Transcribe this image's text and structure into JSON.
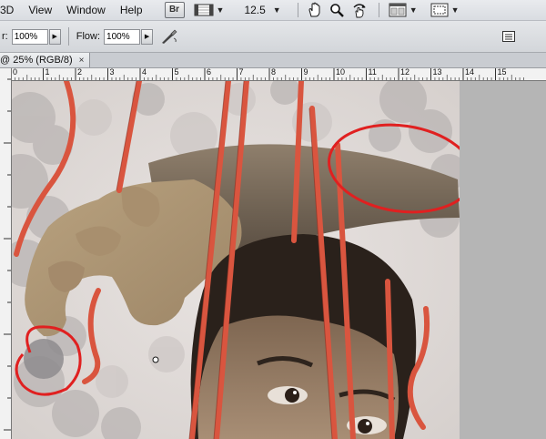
{
  "menubar": {
    "items": [
      "3D",
      "View",
      "Window",
      "Help"
    ],
    "bridge_label": "Br",
    "zoom_value": "12.5"
  },
  "options": {
    "opacity_label": "r:",
    "opacity_value": "100%",
    "flow_label": "Flow:",
    "flow_value": "100%"
  },
  "document": {
    "tab_title": "@ 25% (RGB/8)",
    "close_symbol": "×"
  },
  "ruler": {
    "labels": [
      "0",
      "1",
      "2",
      "3",
      "4",
      "5",
      "6",
      "7",
      "8",
      "9",
      "10",
      "11",
      "12",
      "13",
      "14",
      "15"
    ]
  },
  "icons": [
    "bridge-icon",
    "screen-mode-icon",
    "hand-tool-icon",
    "zoom-tool-icon",
    "rotate-view-icon",
    "arrange-documents-icon",
    "screen-layout-icon",
    "brush-preset-icon",
    "airbrush-icon",
    "panel-toggle-icon"
  ],
  "colors": {
    "annotation_red": "#e02020",
    "string_red": "#d9553f"
  }
}
